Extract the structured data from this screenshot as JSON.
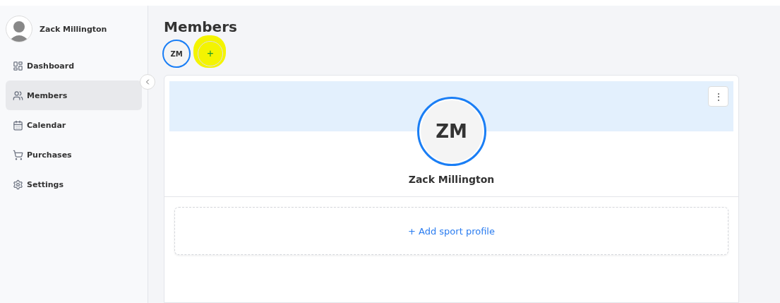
{
  "user": {
    "name": "Zack Millington"
  },
  "sidebar": {
    "items": [
      {
        "label": "Dashboard",
        "selected": false
      },
      {
        "label": "Members",
        "selected": true
      },
      {
        "label": "Calendar",
        "selected": false
      },
      {
        "label": "Purchases",
        "selected": false
      },
      {
        "label": "Settings",
        "selected": false
      }
    ]
  },
  "page": {
    "title": "Members",
    "member_chips": [
      "ZM"
    ],
    "add_button": "+",
    "add_highlighted": true
  },
  "card": {
    "initials": "ZM",
    "name": "Zack Millington",
    "menu": "⋮",
    "add_profile": "+ Add sport profile"
  }
}
